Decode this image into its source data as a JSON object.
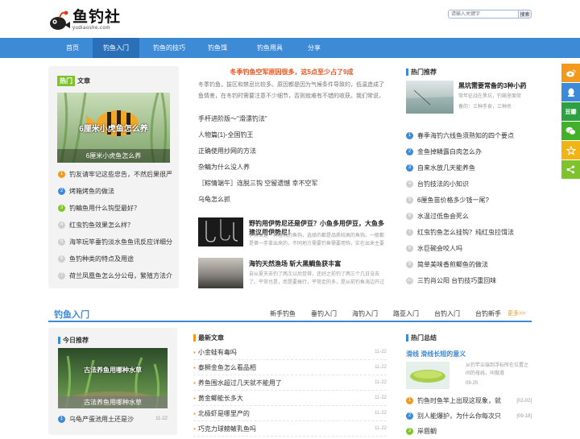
{
  "site": {
    "name": "鱼钓社",
    "domain": "yudiaoshe.com"
  },
  "search": {
    "placeholder": "请输入关键字",
    "button": "搜索"
  },
  "nav": {
    "items": [
      {
        "label": "首页"
      },
      {
        "label": "钓鱼入门"
      },
      {
        "label": "钓鱼的技巧"
      },
      {
        "label": "钓鱼饵"
      },
      {
        "label": "钓鱼用具"
      },
      {
        "label": "分享"
      }
    ]
  },
  "left_panel": {
    "tag": "热门",
    "title": "文章",
    "featured_image_text": "6厘米小虎鱼怎么养",
    "featured_caption": "6厘米小虎鱼怎么养",
    "items": [
      {
        "num": "1",
        "title": "钓友请牢记这些忠告，不然后果很严"
      },
      {
        "num": "2",
        "title": "烤箱烤鱼的做法"
      },
      {
        "num": "3",
        "title": "钓鳊鱼用什么钩型最好？"
      },
      {
        "num": "4",
        "title": "红虫钓鱼效果怎么样？"
      },
      {
        "num": "5",
        "title": "海竿玩竿垂钓淡水鱼鱼讯反应详细分"
      },
      {
        "num": "6",
        "title": "鱼钓种类的特点及用途"
      },
      {
        "num": "7",
        "title": "荷兰凤凰鱼怎么分公母，繁殖方法介"
      }
    ]
  },
  "center": {
    "headline": "冬季钓鱼空军原因很多，这5点至少占了9成",
    "summary": "冬季钓鱼，拔区和禁忌比较多。原因都是因为气候条件导致的，低温造成了鱼情差，在冬钓时需要注意不少细节，否则就难有不错的收获。我们常说，",
    "links": [
      "手杆进阶版～\"滑漂钓法\"",
      "人物篇(1)-全国钓王",
      "正确使用抄网的方法",
      "杂鳊为什么没人养",
      "［粽情端午］连脱三钩  空留遗憾  幸不空军",
      "乌龟怎么抓"
    ],
    "cards": [
      {
        "title": "野钓用伊势尼还是伊豆？小鱼多用伊豆，大鱼多建议用伊势尼！",
        "desc": "伊势尼是一种粗钩的鱼钩，选择的都是品质较高的鱼钩，一般都是第一手拿出来的，不同地方需要钓鱼需要用钩，实在出来主要就是野钓中的鱼"
      },
      {
        "title": "海钓天然渔场 斩大黑鲷鱼获丰富",
        "desc": "自从夏天去钓了两次以后觉得，还好之前钓了两三个几日没去了。平常也是，而是要搞行，平常走的多，是从前钓鱼海边开过"
      }
    ]
  },
  "right_panel": {
    "title": "热门推荐",
    "top_title": "黑坑需要常备的3种小药",
    "top_desc": "常年征战在黑坑，钓箱里面常备的：三种手食，三种杀",
    "items": [
      {
        "num": "1",
        "title": "春季海钓六线鱼须熟知的四个要点"
      },
      {
        "num": "2",
        "title": "金鱼掉鳞露白肉怎么办"
      },
      {
        "num": "3",
        "title": "自来水放几天能养鱼"
      },
      {
        "num": "4",
        "title": "台钓技法的小知识"
      },
      {
        "num": "5",
        "title": "6厘鱼苗价格多少钱一尾?"
      },
      {
        "num": "6",
        "title": "水温过低鱼会死么"
      },
      {
        "num": "7",
        "title": "红虫钓鱼怎么挂钩？纯红虫拉饵法"
      },
      {
        "num": "8",
        "title": "水巨碗会咬人吗"
      },
      {
        "num": "9",
        "title": "简单美味香煎鲫鱼的做法"
      },
      {
        "num": "10",
        "title": "三钓肖公阳 台钓技巧重回味"
      }
    ]
  },
  "section": {
    "title": "钓鱼入门",
    "tabs": [
      "新手钓鱼",
      "垂钓入门",
      "海钓入门",
      "路亚入门",
      "台钓入门",
      "台钓新手"
    ],
    "more": "更多>>"
  },
  "today": {
    "title": "今日推荐",
    "image_text": "古法养鱼用哪种水草",
    "caption": "古法养鱼用哪种水草",
    "items": [
      {
        "num": "1",
        "title": "乌龟产蛋池用土还是沙",
        "date": "11-22"
      }
    ]
  },
  "latest": {
    "title": "最新文章",
    "items": [
      {
        "title": "小金蛙有毒吗",
        "date": "11-22"
      },
      {
        "title": "泰狮金鱼怎么看品相",
        "date": "11-22"
      },
      {
        "title": "养鱼围水超过几天就不能用了",
        "date": "11-22"
      },
      {
        "title": "黄金鲫能长多大",
        "date": "11-22"
      },
      {
        "title": "北极虾是哪里产的",
        "date": "11-22"
      },
      {
        "title": "巧克力球鳑鲏乳鱼吗",
        "date": "11-22"
      }
    ]
  },
  "hot_summary": {
    "title": "热门总结",
    "headline": "滑线 滑线长短的意义",
    "desc": "从钓竿尖端到浮标所在位置之间的母线，叫做滑",
    "date": "09-25",
    "items": [
      {
        "num": "1",
        "title": "钓鱼时鱼竿上出现这现象，就",
        "date": "[02-02]"
      },
      {
        "num": "2",
        "title": "别人能爆护，为什么你每次只",
        "date": "[09-18]"
      },
      {
        "num": "3",
        "title": "岸唇鲷",
        "date": ""
      }
    ]
  },
  "share_icons": [
    {
      "name": "weibo-icon",
      "color": "#f39a1e"
    },
    {
      "name": "qq-icon",
      "color": "#3d8ad6"
    },
    {
      "name": "douban-icon",
      "color": "#2ea043"
    },
    {
      "name": "wechat-icon",
      "color": "#43b02a"
    },
    {
      "name": "star-icon",
      "color": "#f2b316"
    },
    {
      "name": "share-icon",
      "color": "#7ec32c"
    }
  ]
}
